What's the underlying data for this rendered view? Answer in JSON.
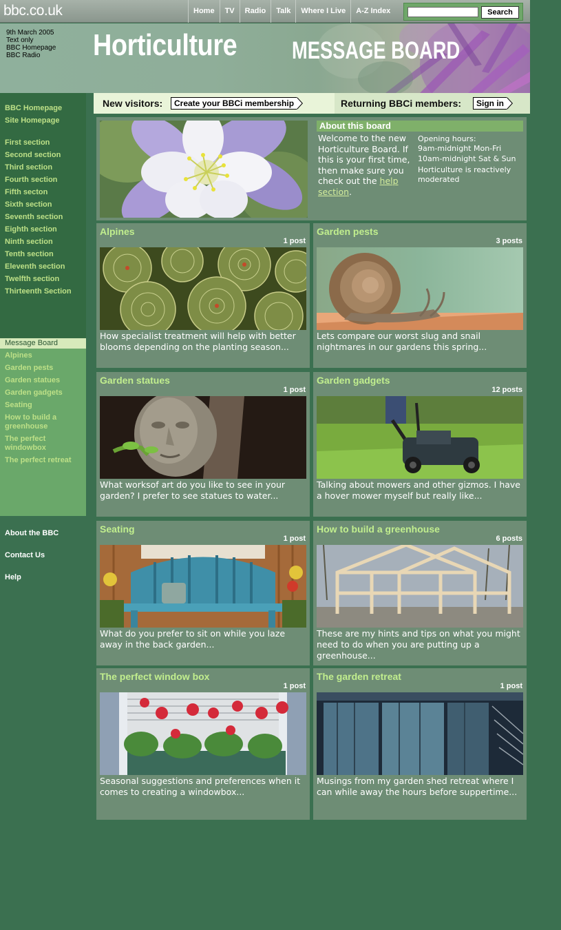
{
  "header": {
    "logo": "bbc.co.uk",
    "nav": [
      "Home",
      "TV",
      "Radio",
      "Talk",
      "Where I Live",
      "A-Z Index"
    ],
    "search": {
      "value": "",
      "button": "Search"
    }
  },
  "banner": {
    "date": "9th March 2005",
    "links": [
      "Text only",
      "BBC Homepage",
      "BBC Radio"
    ],
    "title_main": "Horticulture",
    "title_sub": "MESSAGE BOARD"
  },
  "membership": {
    "new_label": "New visitors:",
    "new_button": "Create your BBCi membership",
    "returning_label": "Returning BBCi members:",
    "returning_button": "Sign in"
  },
  "sidebar": {
    "top_links": [
      "BBC Homepage",
      "Site Homepage"
    ],
    "sections": [
      "First section",
      "Second section",
      "Third section",
      "Fourth section",
      "Fifth secton",
      "Sixth section",
      "Seventh section",
      "Eighth section",
      "Ninth section",
      "Tenth section",
      "Eleventh section",
      "Twelfth section",
      "Thirteenth Section"
    ],
    "board_heading": "Message Board",
    "board_links": [
      "Alpines",
      "Garden pests",
      "Garden statues",
      "Garden gadgets",
      "Seating",
      "How to build a greenhouse",
      "The perfect windowbox",
      "The perfect retreat"
    ],
    "bottom_links": [
      "About the BBC",
      "Contact Us",
      "Help"
    ]
  },
  "about": {
    "heading": "About this board",
    "text": "Welcome to the new Horticulture Board. If this is your first time, then make sure you check out the",
    "link": "help section",
    "after": ".",
    "hours_label": "Opening hours:",
    "hours": [
      "9am-midnight Mon-Fri",
      "10am-midnight Sat & Sun"
    ],
    "moderation": "Horticulture is reactively moderated"
  },
  "boards": [
    {
      "title": "Alpines",
      "posts": "1 post",
      "desc": "How specialist treatment will help with better blooms depending on the planting season..."
    },
    {
      "title": "Garden pests",
      "posts": "3 posts",
      "desc": "Lets compare our worst slug and snail nightmares in our gardens this spring..."
    },
    {
      "title": "Garden statues",
      "posts": "1 post",
      "desc": "What worksof art do you like to see in your garden? I prefer to see statues to water..."
    },
    {
      "title": "Garden gadgets",
      "posts": "12 posts",
      "desc": "Talking about mowers and other gizmos. I have a hover mower myself but really like..."
    },
    {
      "title": "Seating",
      "posts": "1 post",
      "desc": "What do you prefer to sit on while you laze away in the back garden..."
    },
    {
      "title": "How to build a greenhouse",
      "posts": "6 posts",
      "desc": "These are my hints and tips on what you might need to do when you are putting up a greenhouse..."
    },
    {
      "title": "The perfect window box",
      "posts": "1 post",
      "desc": "Seasonal suggestions and preferences when it comes to creating a windowbox..."
    },
    {
      "title": "The garden retreat",
      "posts": "1 post",
      "desc": "Musings from my garden shed retreat where I can while away the hours before suppertime..."
    }
  ],
  "colors": {
    "page_bg": "#3b7050",
    "card_bg": "#6e8d75",
    "title_green": "#c1ee8e",
    "sidebar_dark": "#336a42",
    "sidebar_light": "#6aa86a"
  }
}
